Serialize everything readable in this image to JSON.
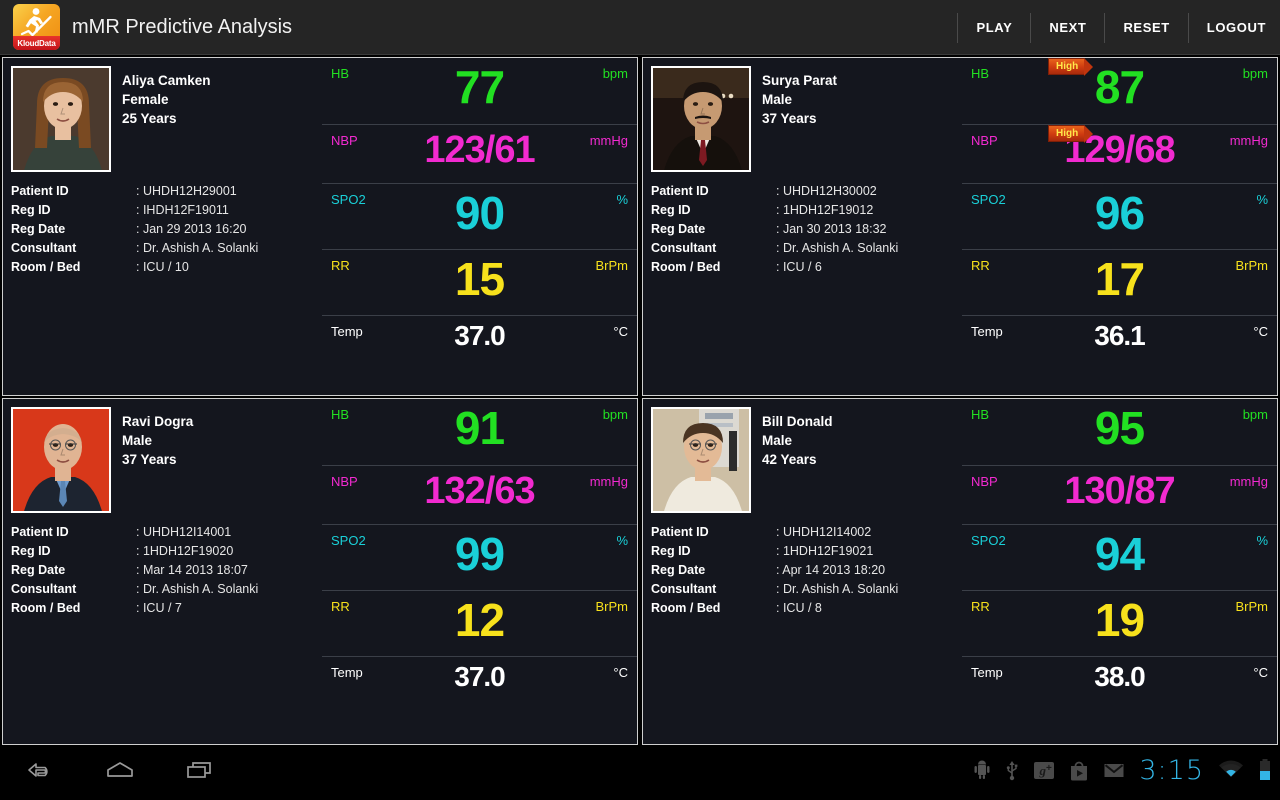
{
  "header": {
    "app_title": "mMR Predictive Analysis",
    "logo_label": "KloudData",
    "logo_icon": "runner-chart-icon",
    "actions": [
      {
        "label": "PLAY",
        "name": "play-button"
      },
      {
        "label": "NEXT",
        "name": "next-button"
      },
      {
        "label": "RESET",
        "name": "reset-button"
      },
      {
        "label": "LOGOUT",
        "name": "logout-button"
      }
    ]
  },
  "field_labels": {
    "patient_id": "Patient ID",
    "reg_id": "Reg ID",
    "reg_date": "Reg Date",
    "consultant": "Consultant",
    "room_bed": "Room / Bed"
  },
  "colors": {
    "hb": "#22e022",
    "nbp": "#f22ad0",
    "spo2": "#1ad0d8",
    "rr": "#f7e11c",
    "temp": "#ffffff",
    "badge_bg": "#cf3b10",
    "badge_text": "#ffe94a",
    "accent_clock": "#33b5e5",
    "card_bg": "#14161e",
    "header_bg": "#252525"
  },
  "patients": [
    {
      "name": "Aliya Camken",
      "gender": "Female",
      "age": "25 Years",
      "patient_id": ": UHDH12H29001",
      "reg_id": ": IHDH12F19011",
      "reg_date": ": Jan 29 2013 16:20",
      "consultant": ": Dr. Ashish A. Solanki",
      "room_bed": ": ICU / 10",
      "vitals": {
        "hb": {
          "label": "HB",
          "value": "77",
          "unit": "bpm",
          "alert": ""
        },
        "nbp": {
          "label": "NBP",
          "value": "123/61",
          "unit": "mmHg",
          "alert": ""
        },
        "spo2": {
          "label": "SPO2",
          "value": "90",
          "unit": "%",
          "alert": ""
        },
        "rr": {
          "label": "RR",
          "value": "15",
          "unit": "BrPm",
          "alert": ""
        },
        "temp": {
          "label": "Temp",
          "value": "37.0",
          "unit": "°C",
          "alert": ""
        }
      }
    },
    {
      "name": "Surya Parat",
      "gender": "Male",
      "age": "37 Years",
      "patient_id": ": UHDH12H30002",
      "reg_id": ": 1HDH12F19012",
      "reg_date": ": Jan 30 2013 18:32",
      "consultant": ": Dr. Ashish A. Solanki",
      "room_bed": ": ICU / 6",
      "vitals": {
        "hb": {
          "label": "HB",
          "value": "87",
          "unit": "bpm",
          "alert": "High"
        },
        "nbp": {
          "label": "NBP",
          "value": "129/68",
          "unit": "mmHg",
          "alert": "High"
        },
        "spo2": {
          "label": "SPO2",
          "value": "96",
          "unit": "%",
          "alert": ""
        },
        "rr": {
          "label": "RR",
          "value": "17",
          "unit": "BrPm",
          "alert": ""
        },
        "temp": {
          "label": "Temp",
          "value": "36.1",
          "unit": "°C",
          "alert": ""
        }
      }
    },
    {
      "name": "Ravi  Dogra",
      "gender": "Male",
      "age": "37 Years",
      "patient_id": ": UHDH12I14001",
      "reg_id": ": 1HDH12F19020",
      "reg_date": ": Mar 14 2013 18:07",
      "consultant": ": Dr. Ashish A. Solanki",
      "room_bed": ": ICU / 7",
      "vitals": {
        "hb": {
          "label": "HB",
          "value": "91",
          "unit": "bpm",
          "alert": ""
        },
        "nbp": {
          "label": "NBP",
          "value": "132/63",
          "unit": "mmHg",
          "alert": ""
        },
        "spo2": {
          "label": "SPO2",
          "value": "99",
          "unit": "%",
          "alert": ""
        },
        "rr": {
          "label": "RR",
          "value": "12",
          "unit": "BrPm",
          "alert": ""
        },
        "temp": {
          "label": "Temp",
          "value": "37.0",
          "unit": "°C",
          "alert": ""
        }
      }
    },
    {
      "name": "Bill Donald",
      "gender": "Male",
      "age": "42 Years",
      "patient_id": ": UHDH12I14002",
      "reg_id": ": 1HDH12F19021",
      "reg_date": ": Apr 14 2013 18:20",
      "consultant": ": Dr. Ashish A. Solanki",
      "room_bed": ": ICU / 8",
      "vitals": {
        "hb": {
          "label": "HB",
          "value": "95",
          "unit": "bpm",
          "alert": ""
        },
        "nbp": {
          "label": "NBP",
          "value": "130/87",
          "unit": "mmHg",
          "alert": ""
        },
        "spo2": {
          "label": "SPO2",
          "value": "94",
          "unit": "%",
          "alert": ""
        },
        "rr": {
          "label": "RR",
          "value": "19",
          "unit": "BrPm",
          "alert": ""
        },
        "temp": {
          "label": "Temp",
          "value": "38.0",
          "unit": "°C",
          "alert": ""
        }
      }
    }
  ],
  "system_bar": {
    "nav": [
      "back-icon",
      "home-icon",
      "recents-icon"
    ],
    "tray_icons": [
      "android-debug-icon",
      "usb-icon",
      "google-plus-icon",
      "play-store-icon",
      "gmail-icon"
    ],
    "clock": "3:15",
    "wifi_icon": "wifi-icon",
    "battery_icon": "battery-icon"
  }
}
